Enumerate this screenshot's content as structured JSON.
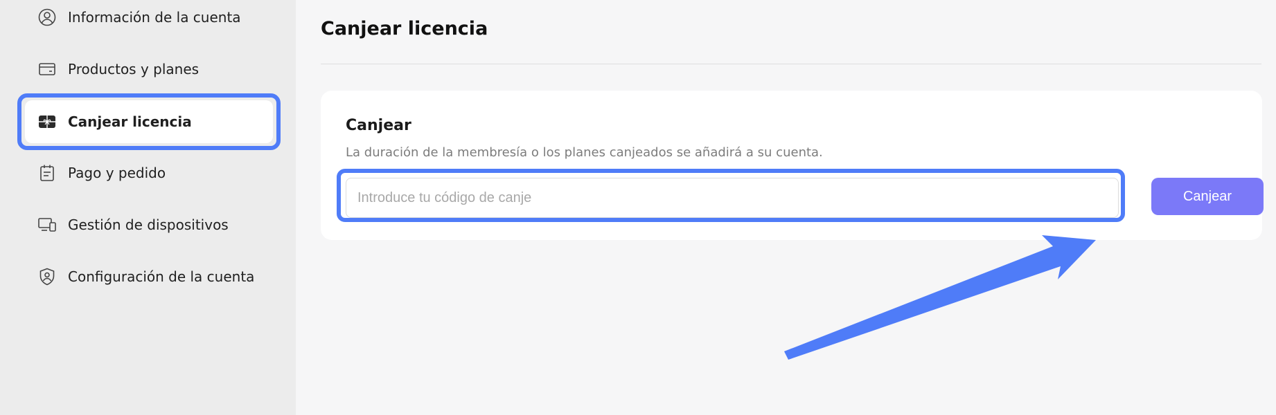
{
  "sidebar": {
    "items": [
      {
        "label": "Información de la cuenta",
        "icon": "user-circle-icon"
      },
      {
        "label": "Productos y planes",
        "icon": "card-icon"
      },
      {
        "label": "Canjear licencia",
        "icon": "gift-icon",
        "active": true
      },
      {
        "label": "Pago y pedido",
        "icon": "clipboard-icon"
      },
      {
        "label": "Gestión de dispositivos",
        "icon": "devices-icon"
      },
      {
        "label": "Configuración de la cuenta",
        "icon": "shield-user-icon"
      }
    ]
  },
  "main": {
    "title": "Canjear licencia",
    "card": {
      "title": "Canjear",
      "description": "La duración de la membresía o los planes canjeados se añadirá a su cuenta.",
      "input_placeholder": "Introduce tu código de canje",
      "input_value": "",
      "button_label": "Canjear"
    }
  },
  "colors": {
    "highlight": "#4f7cf8",
    "button": "#7b79f8"
  }
}
